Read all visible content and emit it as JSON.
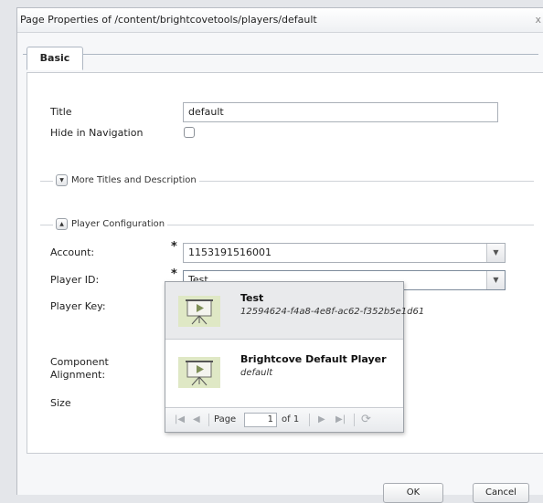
{
  "dialog": {
    "title": "Page Properties of /content/brightcovetools/players/default",
    "close_glyph": "x"
  },
  "tabs": [
    {
      "label": "Basic",
      "active": true
    }
  ],
  "basic": {
    "title_label": "Title",
    "title_value": "default",
    "hide_nav_label": "Hide in Navigation",
    "hide_nav_checked": false
  },
  "more_titles": {
    "legend": "More Titles and Description",
    "expanded": false
  },
  "player_config": {
    "legend": "Player Configuration",
    "expanded": true,
    "account_label": "Account:",
    "account_value": "1153191516001",
    "player_id_label": "Player ID:",
    "player_id_value": "Test",
    "player_key_label": "Player Key:",
    "component_label_line1": "Component",
    "component_label_line2": "Alignment:",
    "size_label": "Size",
    "required_marker": "*"
  },
  "dropdown": {
    "options": [
      {
        "name": "Test",
        "sub": "12594624-f4a8-4e8f-ac62-f352b5e1d61",
        "selected": true,
        "icon": "presentation-screen-icon"
      },
      {
        "name": "Brightcove Default Player",
        "sub": "default",
        "selected": false,
        "icon": "presentation-screen-icon"
      }
    ],
    "pager": {
      "page_label": "Page",
      "page_value": "1",
      "of_label": "of 1",
      "first": "|◀",
      "prev": "◀",
      "next": "▶",
      "last": "▶|",
      "refresh": "⟳"
    }
  },
  "buttons": {
    "ok": "OK",
    "cancel": "Cancel"
  },
  "colors": {
    "thumb_bg": "#dfe8c5",
    "dialog_bg": "#f6f7f9"
  }
}
